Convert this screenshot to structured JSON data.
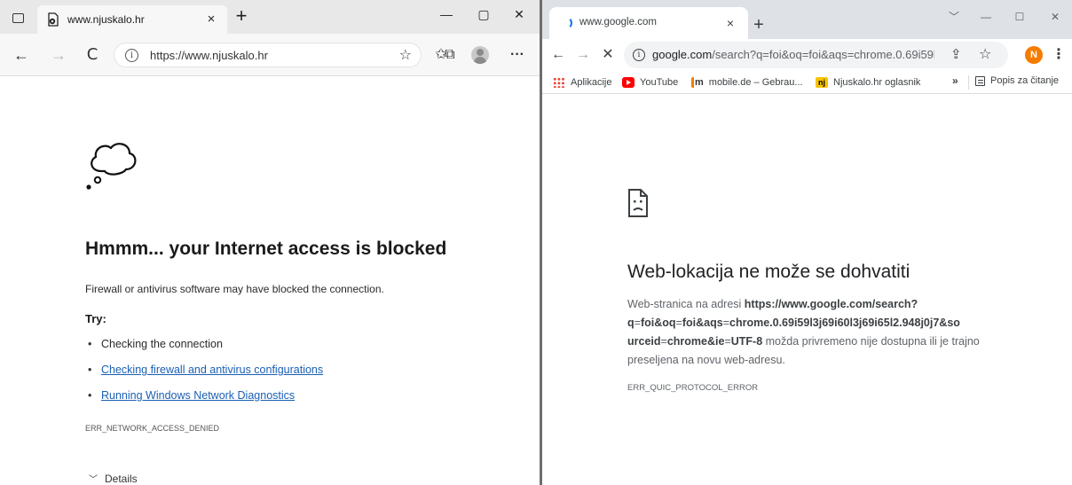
{
  "edge": {
    "tab_title": "www.njuskalo.hr",
    "tab_close": "×",
    "new_tab": "+",
    "window_controls": {
      "minimize": "—",
      "maximize": "▢",
      "close": "✕"
    },
    "toolbar": {
      "back": "←",
      "forward": "→",
      "refresh": "C",
      "address_url": "https://www.njuskalo.hr",
      "more": "···"
    },
    "error_page": {
      "heading": "Hmmm... your Internet access is blocked",
      "description": "Firewall or antivirus software may have blocked the connection.",
      "try_label": "Try:",
      "suggestions": [
        {
          "text": "Checking the connection",
          "link": false
        },
        {
          "text": "Checking firewall and antivirus configurations",
          "link": true
        },
        {
          "text": "Running Windows Network Diagnostics",
          "link": true
        }
      ],
      "error_code": "ERR_NETWORK_ACCESS_DENIED",
      "details_label": "Details"
    }
  },
  "chrome": {
    "tab_title": "www.google.com",
    "tab_close": "×",
    "new_tab": "+",
    "window_controls": {
      "dropdown": "﹀",
      "minimize": "—",
      "maximize": "☐",
      "close": "✕"
    },
    "toolbar": {
      "back": "←",
      "forward": "→",
      "stop": "✕",
      "address_domain": "google.com",
      "address_path": "/search?q=foi&oq=foi&aqs=chrome.0.69i59l3j69i...",
      "profile_initial": "N",
      "menu": "⋮"
    },
    "bookmarks": {
      "items": [
        {
          "label": "Aplikacije"
        },
        {
          "label": "YouTube"
        },
        {
          "label": "mobile.de – Gebrau..."
        },
        {
          "label": "Njuskalo.hr oglasnik"
        }
      ],
      "more": "»",
      "reading_list": "Popis za čitanje"
    },
    "error_page": {
      "heading": "Web-lokacija ne može se dohvatiti",
      "desc_prefix": "Web-stranica na adresi ",
      "desc_url_1": "https://www.google.com/search?",
      "desc_url_2": "q",
      "desc_url_3": "=",
      "desc_url_4": "foi&oq",
      "desc_url_5": "=",
      "desc_url_6": "foi&aqs",
      "desc_url_7": "=",
      "desc_url_8": "chrome.0.69i59l3j69i60l3j69i65l2.948j0j7&so urceid",
      "desc_url_9": "=",
      "desc_url_10": "chrome&ie",
      "desc_url_11": "=",
      "desc_url_12": "UTF-8",
      "desc_suffix": " možda privremeno nije dostupna ili je trajno preseljena na novu web-adresu.",
      "error_code": "ERR_QUIC_PROTOCOL_ERROR"
    }
  }
}
